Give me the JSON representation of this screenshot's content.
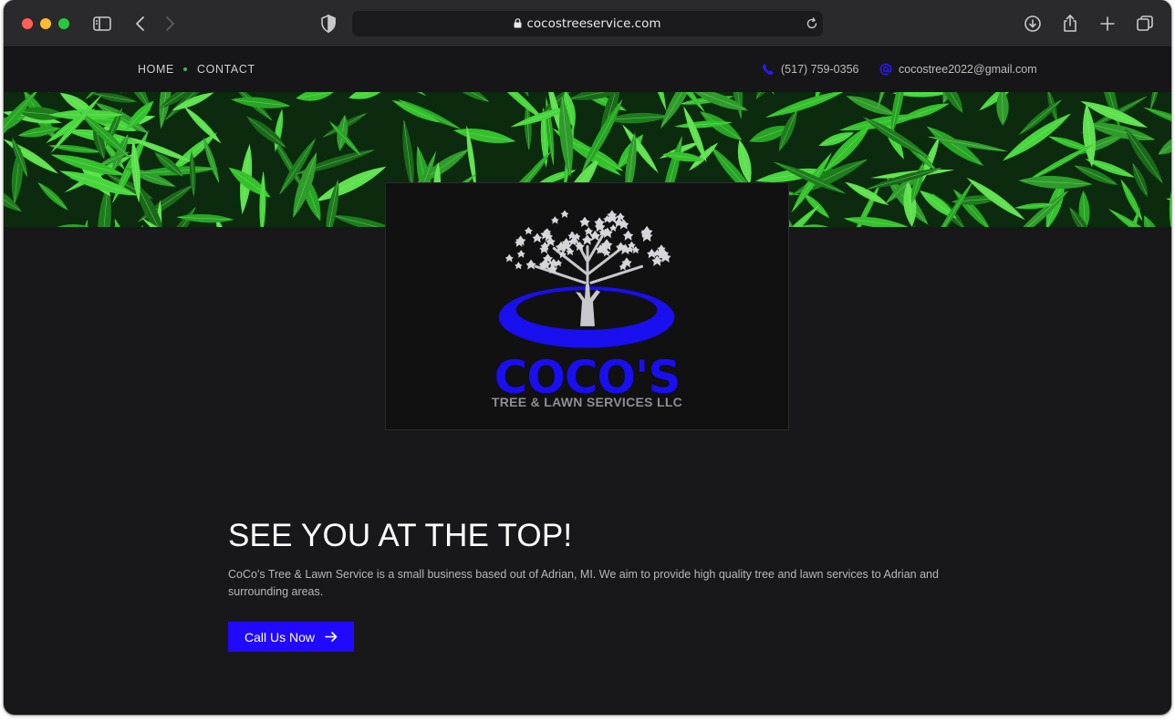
{
  "browser": {
    "url": "cocostreeservice.com",
    "icons": [
      "sidebar-icon",
      "back-icon",
      "forward-icon",
      "shield-icon",
      "lock-icon",
      "reload-icon",
      "download-icon",
      "share-icon",
      "new-tab-icon",
      "tabs-overview-icon"
    ]
  },
  "header": {
    "nav": [
      {
        "label": "HOME"
      },
      {
        "label": "CONTACT"
      }
    ],
    "phone": "(517) 759-0356",
    "email": "cocostree2022@gmail.com"
  },
  "logo": {
    "wordmark": "COCO'S",
    "tagline": "TREE & LAWN SERVICES LLC"
  },
  "hero": {
    "headline": "SEE YOU AT THE TOP!",
    "description": "CoCo's Tree & Lawn Service is a small business based out of Adrian, MI. We aim to provide high quality tree and lawn services to Adrian and surrounding areas.",
    "cta_label": "Call Us Now"
  },
  "colors": {
    "accent": "#2109ff",
    "background": "#18181b",
    "nav_dot": "#3fb950"
  }
}
